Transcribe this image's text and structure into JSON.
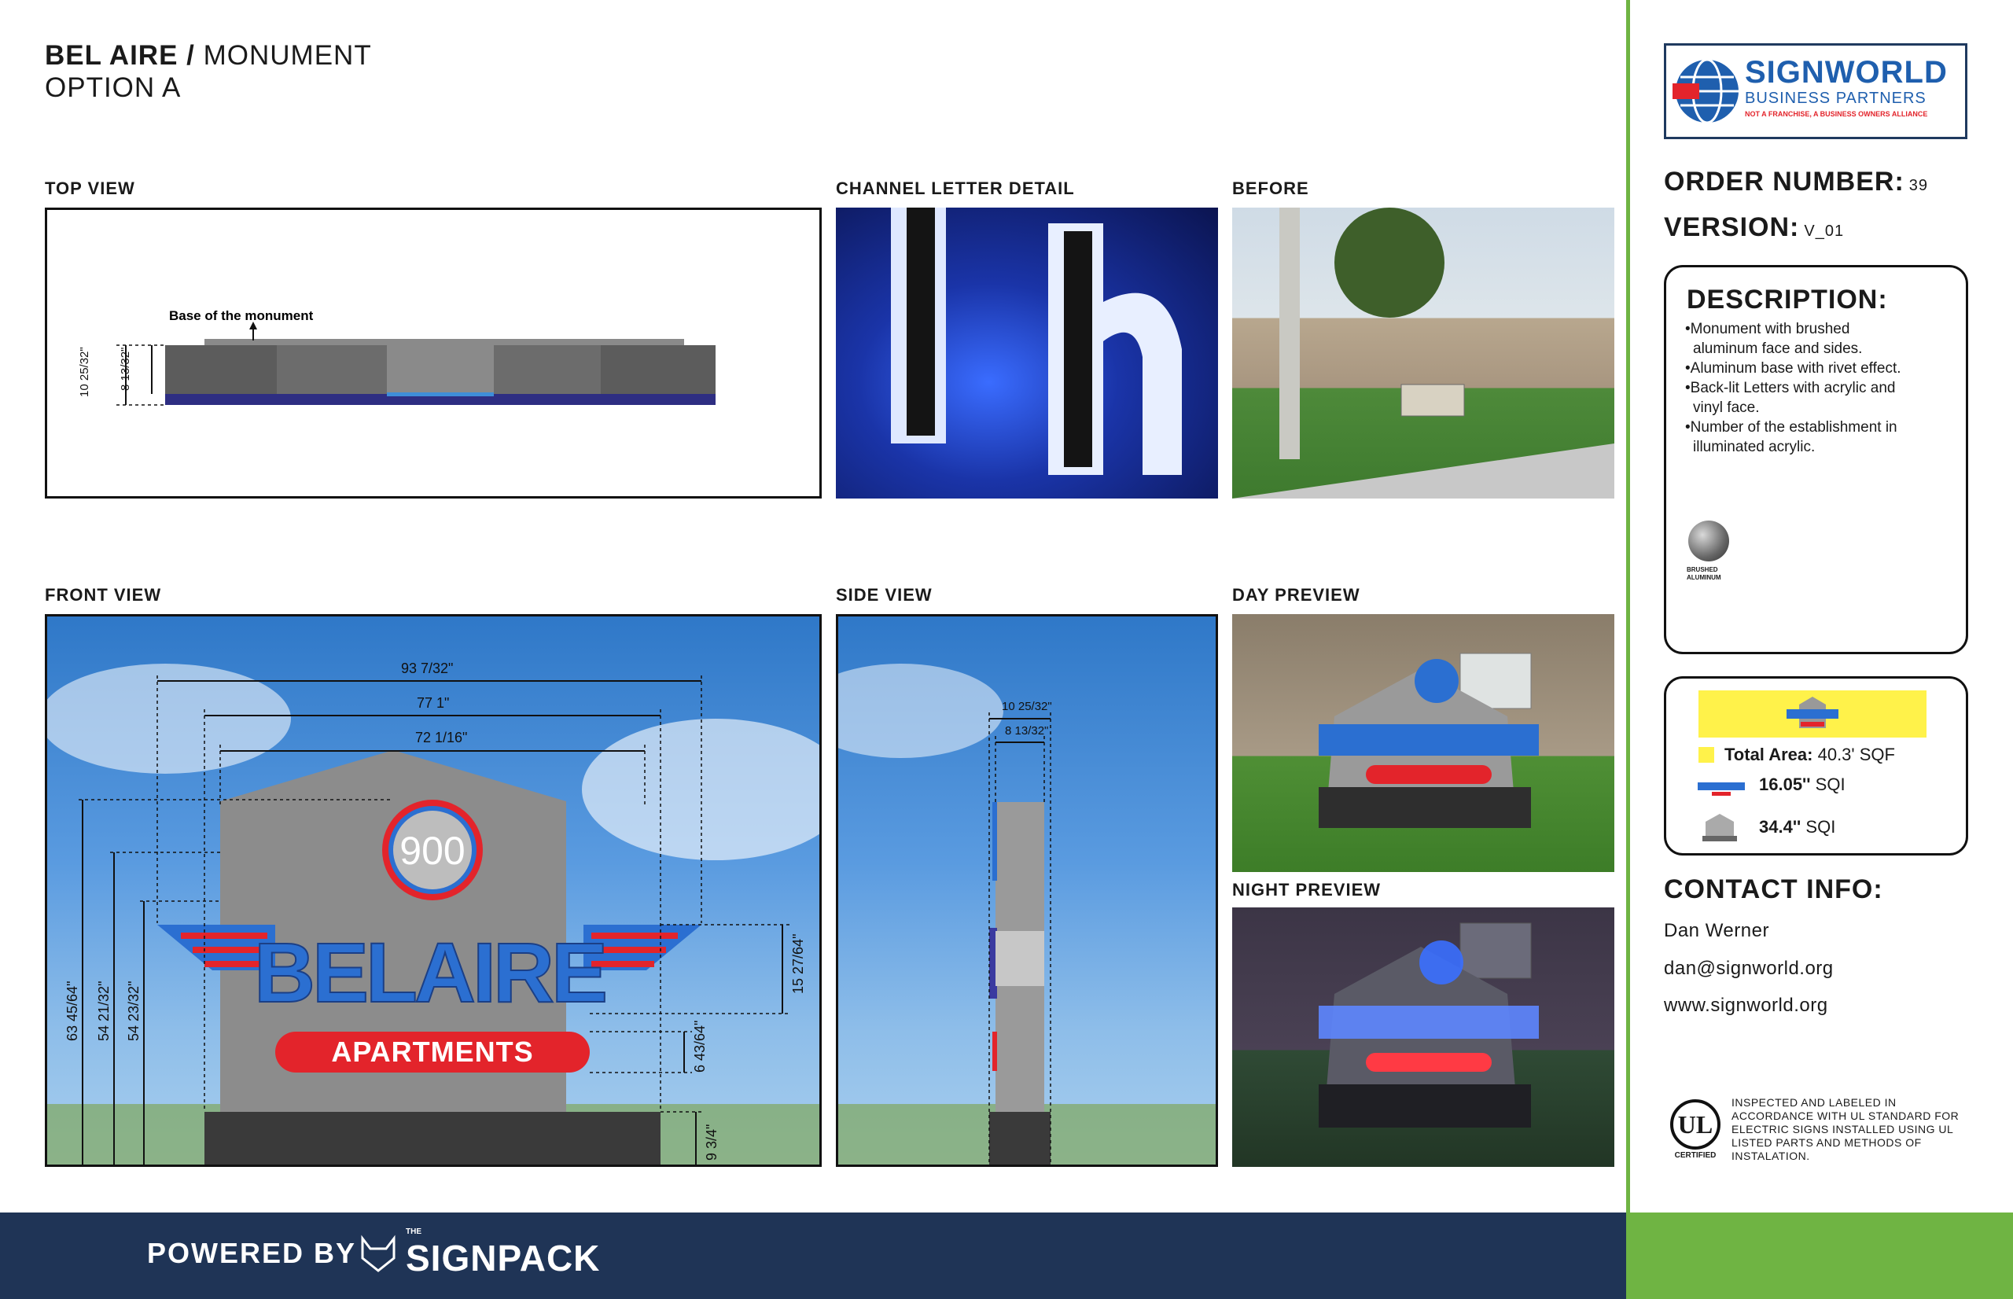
{
  "header": {
    "title_bold": "BEL AIRE",
    "title_sep": " / ",
    "title_rest": "MONUMENT",
    "subtitle": "OPTION A"
  },
  "sections": {
    "top_view": "TOP VIEW",
    "channel_letter": "CHANNEL LETTER DETAIL",
    "before": "BEFORE",
    "front_view": "FRONT VIEW",
    "side_view": "SIDE VIEW",
    "day_preview": "DAY PREVIEW",
    "night_preview": "NIGHT PREVIEW"
  },
  "top_view": {
    "base_label": "Base of the monument",
    "dim_outer": "10 25/32\"",
    "dim_inner": "8 13/32\""
  },
  "front_view": {
    "dim_width_1": "93 7/32\"",
    "dim_width_2": "77 1\"",
    "dim_width_3": "72 1/16\"",
    "dim_height_1": "63 45/64\"",
    "dim_height_2": "54 21/32\"",
    "dim_height_3": "54 23/32\"",
    "dim_wing": "15 27/64\"",
    "dim_panel": "6 43/64\"",
    "dim_base": "9 3/4\""
  },
  "side_view": {
    "dim_outer": "10 25/32\"",
    "dim_inner": "8 13/32\""
  },
  "sign": {
    "number": "900",
    "name": "BELAIRE",
    "tagline": "APARTMENTS"
  },
  "logo": {
    "brand": "SIGNWORLD",
    "sub": "BUSINESS PARTNERS",
    "tagline": "NOT A FRANCHISE, A BUSINESS OWNERS ALLIANCE"
  },
  "order": {
    "order_label": "ORDER NUMBER:",
    "order_value": "39",
    "version_label": "VERSION:",
    "version_value": "V_01"
  },
  "description": {
    "title": "DESCRIPTION:",
    "items": [
      "•Monument with brushed aluminum face and sides.",
      "•Aluminum base with rivet effect.",
      "•Back-lit Letters with acrylic and vinyl face.",
      "•Number of the establishment in illuminated acrylic."
    ],
    "swatch_label_1": "BRUSHED",
    "swatch_label_2": "ALUMINUM"
  },
  "area": {
    "total_label": "Total Area:",
    "total_value": "40.3' SQF",
    "item1_value": "16.05''",
    "item1_unit": "SQI",
    "item2_value": "34.4''",
    "item2_unit": "SQI"
  },
  "contact": {
    "title": "CONTACT INFO:",
    "name": "Dan Werner",
    "email": "dan@signworld.org",
    "website": "www.signworld.org"
  },
  "ul": {
    "mark": "UL",
    "certified": "CERTIFIED",
    "text": "INSPECTED AND LABELED IN ACCORDANCE WITH UL STANDARD FOR ELECTRIC SIGNS INSTALLED USING UL LISTED PARTS AND METHODS OF INSTALATION."
  },
  "footer": {
    "powered_by": "POWERED BY",
    "the": "THE",
    "brand": "SIGNPACK"
  },
  "colors": {
    "accent_green": "#6fb443",
    "footer_navy": "#1f3456",
    "sign_blue": "#2b6fd1",
    "sign_red": "#e3242b",
    "highlight_yellow": "#fff24a"
  }
}
